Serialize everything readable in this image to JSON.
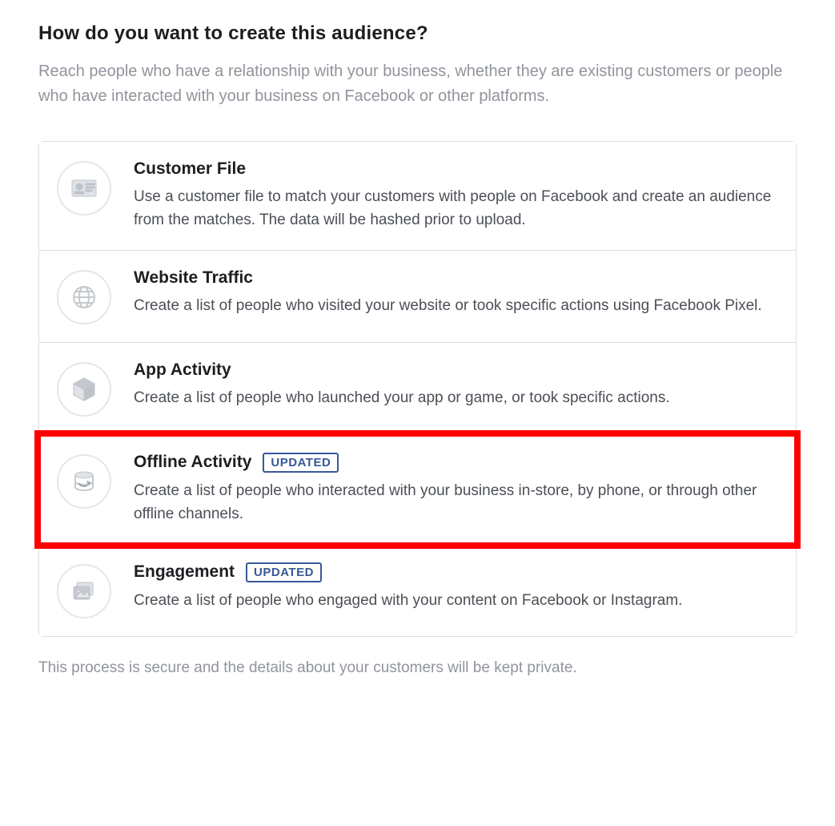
{
  "header": {
    "title": "How do you want to create this audience?",
    "subtitle": "Reach people who have a relationship with your business, whether they are existing customers or people who have interacted with your business on Facebook or other platforms."
  },
  "options": [
    {
      "icon": "id-card-icon",
      "title": "Customer File",
      "badge": null,
      "desc": "Use a customer file to match your customers with people on Facebook and create an audience from the matches. The data will be hashed prior to upload.",
      "highlighted": false
    },
    {
      "icon": "globe-icon",
      "title": "Website Traffic",
      "badge": null,
      "desc": "Create a list of people who visited your website or took specific actions using Facebook Pixel.",
      "highlighted": false
    },
    {
      "icon": "cube-icon",
      "title": "App Activity",
      "badge": null,
      "desc": "Create a list of people who launched your app or game, or took specific actions.",
      "highlighted": false
    },
    {
      "icon": "sync-icon",
      "title": "Offline Activity",
      "badge": "UPDATED",
      "desc": "Create a list of people who interacted with your business in-store, by phone, or through other offline channels.",
      "highlighted": true
    },
    {
      "icon": "cards-icon",
      "title": "Engagement",
      "badge": "UPDATED",
      "desc": "Create a list of people who engaged with your content on Facebook or Instagram.",
      "highlighted": false
    }
  ],
  "footer": "This process is secure and the details about your customers will be kept private."
}
